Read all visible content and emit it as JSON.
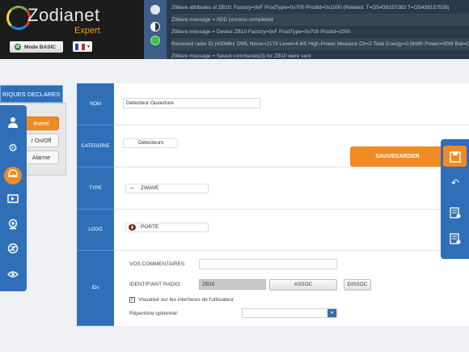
{
  "header": {
    "logo_text": "Zodianet",
    "logo_sub": "Expert",
    "mode_button": "Mode BASIC",
    "flag_colors": [
      "#1f4fa8",
      "#ffffff",
      "#d6262e"
    ]
  },
  "log": {
    "lines": [
      "ZWave attributes of ZB10: Factory=0xF ProdType=0x700 ProdId=0x1000 (Related: T=OS439157283 T=OS439157539)",
      "ZWave message = ADD process completed",
      "ZWave message = Device ZB10 Factory=0xF ProdType=0x700 ProdId=1000",
      "Received radio ID (433Mhz OWL Noise=2173 Level=4.4/5 High-Power Measure Ch=2 Total Energy=0.0kWh Power=00W Bat=OK",
      "ZWave message = Saved commands(3) for ZB10 were sent"
    ]
  },
  "sidebar": {
    "header": "RIQUES DECLARES",
    "tabs": [
      "énérel",
      "r On/Off",
      "Alarme"
    ],
    "icons": [
      "person-icon",
      "gears-icon",
      "alarm-icon",
      "media-icon",
      "webcam-icon",
      "zodianet-icon",
      "eye-icon"
    ]
  },
  "form": {
    "nom": {
      "label": "NOM",
      "value": "Detecteur Ouverture"
    },
    "categorie": {
      "label": "CATEGORIE",
      "value": "Détecteurs"
    },
    "type": {
      "label": "TYPE",
      "value": "ZWAVE"
    },
    "logo": {
      "label": "LOGO",
      "value": "PORTE"
    },
    "ids": {
      "label": "IDs",
      "comments_label": "VOS COMMENTAIRES:",
      "comments_value": "",
      "radio_label": "IDENTIFIANT RADIO:",
      "radio_value": "ZB10",
      "assoc": "ASSOC",
      "dissoc": "DISSOC",
      "visible_label": "Visualisé sur les interfaces de l'utilisateur",
      "visible_checked": true,
      "repertoire_label": "Répertoire optionnel:",
      "repertoire_value": ""
    }
  },
  "actions": {
    "save": "SAUVEGARDER"
  }
}
